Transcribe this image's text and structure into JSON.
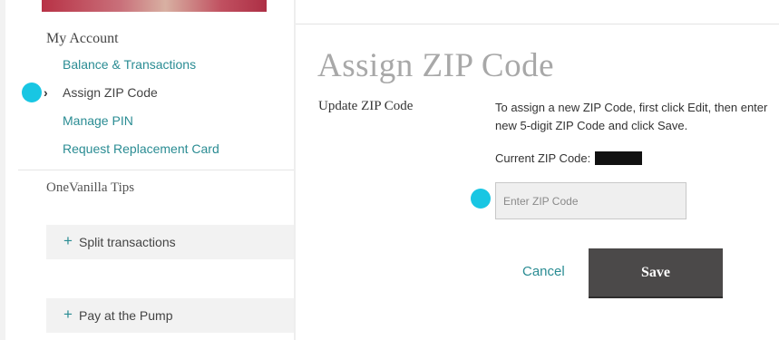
{
  "sidebar": {
    "section_title": "My Account",
    "items": [
      {
        "label": "Balance & Transactions"
      },
      {
        "label": "Assign ZIP Code"
      },
      {
        "label": "Manage PIN"
      },
      {
        "label": "Request Replacement Card"
      }
    ],
    "tips_title": "OneVanilla Tips",
    "tips": [
      {
        "label": "Split transactions"
      },
      {
        "label": "Pay at the Pump"
      }
    ]
  },
  "main": {
    "title": "Assign ZIP Code",
    "field_label": "Update ZIP Code",
    "instructions": "To assign a new ZIP Code, first click Edit, then enter new 5-digit ZIP Code and click Save.",
    "current_zip_label": "Current ZIP Code:",
    "zip_input": {
      "placeholder": "Enter ZIP Code",
      "value": ""
    },
    "cancel_label": "Cancel",
    "save_label": "Save"
  },
  "icons": {
    "plus": "+",
    "chevron": "›"
  },
  "colors": {
    "link": "#2a8c93",
    "focus_marker": "#18c6e3",
    "save_button_bg": "#4b4949"
  }
}
